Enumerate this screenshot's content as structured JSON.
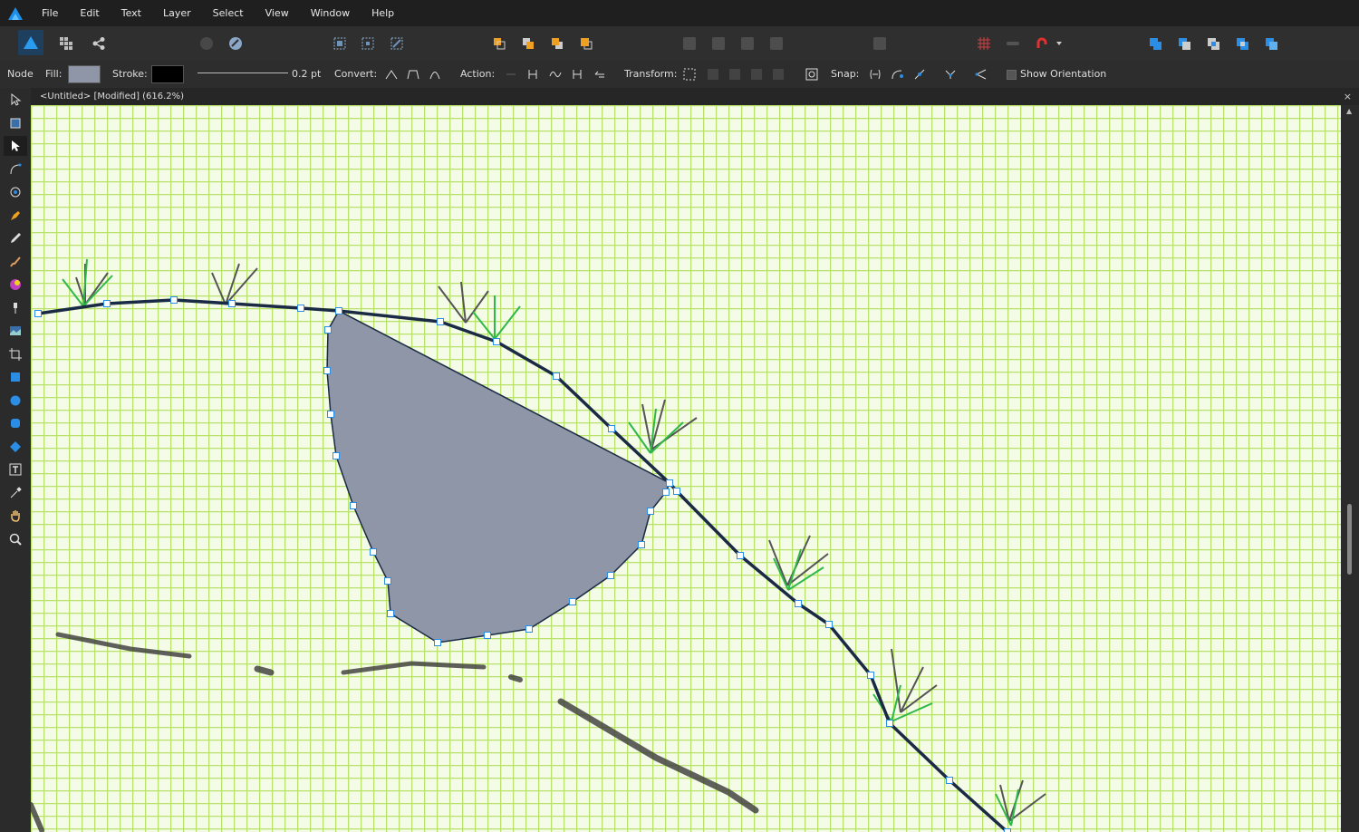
{
  "menu": [
    "File",
    "Edit",
    "Text",
    "Layer",
    "Select",
    "View",
    "Window",
    "Help"
  ],
  "context": {
    "tool_name": "Node",
    "fill_label": "Fill:",
    "fill_color": "#8e96a8",
    "stroke_label": "Stroke:",
    "stroke_color": "#000000",
    "stroke_width": "0.2 pt",
    "convert_label": "Convert:",
    "action_label": "Action:",
    "transform_label": "Transform:",
    "snap_label": "Snap:",
    "show_orientation_label": "Show Orientation",
    "show_orientation_checked": false
  },
  "document": {
    "title": "<Untitled> [Modified] (616.2%)",
    "close_glyph": "×"
  },
  "canvas": {
    "background": "#f4fbe6",
    "grid_color": "#aede55",
    "shape_fill": "#8e96a8",
    "path_stroke": "#1a2a44",
    "node_color": "#ffffff",
    "accent": "#2a8ee6"
  },
  "icons": {
    "app": "affinity-designer-logo",
    "scroll_up": "▲"
  }
}
